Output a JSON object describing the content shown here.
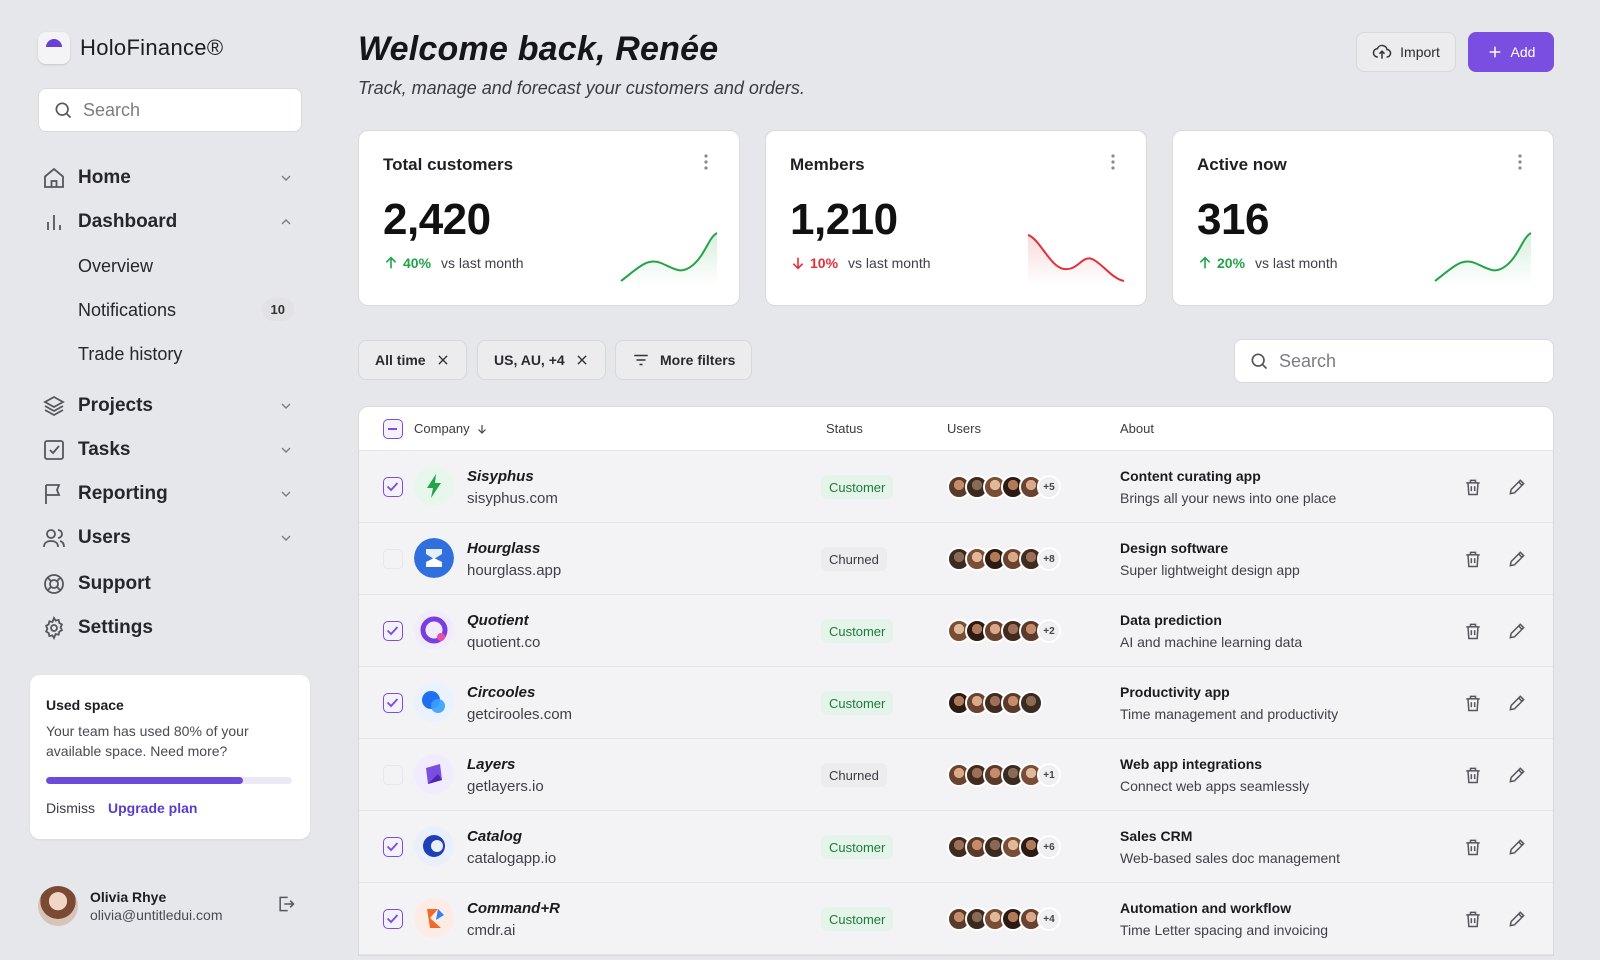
{
  "app": {
    "name": "HoloFinance®"
  },
  "sidebar": {
    "search_placeholder": "Search",
    "nav": [
      {
        "label": "Home",
        "icon": "home-icon",
        "expanded": false
      },
      {
        "label": "Dashboard",
        "icon": "bar-chart-icon",
        "expanded": true
      },
      {
        "label": "Projects",
        "icon": "layers-icon",
        "expanded": false
      },
      {
        "label": "Tasks",
        "icon": "check-square-icon",
        "expanded": false
      },
      {
        "label": "Reporting",
        "icon": "flag-icon",
        "expanded": false
      },
      {
        "label": "Users",
        "icon": "users-icon",
        "expanded": false
      },
      {
        "label": "Support",
        "icon": "life-buoy-icon"
      },
      {
        "label": "Settings",
        "icon": "gear-icon"
      }
    ],
    "dashboard_sub": [
      {
        "label": "Overview"
      },
      {
        "label": "Notifications",
        "badge": "10"
      },
      {
        "label": "Trade history"
      }
    ],
    "space_card": {
      "title": "Used space",
      "description": "Your team has used 80% of your available space. Need more?",
      "progress_percent": 80,
      "dismiss": "Dismiss",
      "upgrade": "Upgrade plan"
    },
    "user": {
      "name": "Olivia Rhye",
      "email": "olivia@untitledui.com"
    }
  },
  "header": {
    "title": "Welcome back, Renée",
    "subtitle": "Track, manage and forecast your customers and orders.",
    "import_label": "Import",
    "add_label": "Add"
  },
  "stats": [
    {
      "title": "Total customers",
      "value": "2,420",
      "pct": "40%",
      "direction": "up",
      "vs": "vs last month",
      "color": "#22a447"
    },
    {
      "title": "Members",
      "value": "1,210",
      "pct": "10%",
      "direction": "down",
      "vs": "vs last month",
      "color": "#e0303a"
    },
    {
      "title": "Active now",
      "value": "316",
      "pct": "20%",
      "direction": "up",
      "vs": "vs last month",
      "color": "#22a447"
    }
  ],
  "filters": {
    "chips": [
      "All time",
      "US, AU, +4"
    ],
    "more_filters": "More filters",
    "search_placeholder": "Search"
  },
  "table": {
    "headers": {
      "company": "Company",
      "status": "Status",
      "users": "Users",
      "about": "About"
    },
    "rows": [
      {
        "checked": true,
        "name": "Sisyphus",
        "url": "sisyphus.com",
        "status": "Customer",
        "users_extra": "+5",
        "about_title": "Content curating app",
        "about_desc": "Brings all your news into one place",
        "logo": "sisyphus"
      },
      {
        "checked": false,
        "name": "Hourglass",
        "url": "hourglass.app",
        "status": "Churned",
        "users_extra": "+8",
        "about_title": "Design software",
        "about_desc": "Super lightweight design app",
        "logo": "hourglass"
      },
      {
        "checked": true,
        "name": "Quotient",
        "url": "quotient.co",
        "status": "Customer",
        "users_extra": "+2",
        "about_title": "Data prediction",
        "about_desc": "AI and machine learning data",
        "logo": "quotient"
      },
      {
        "checked": true,
        "name": "Circooles",
        "url": "getcirooles.com",
        "status": "Customer",
        "users_extra": "",
        "about_title": "Productivity app",
        "about_desc": "Time management and productivity",
        "logo": "circooles"
      },
      {
        "checked": false,
        "name": "Layers",
        "url": "getlayers.io",
        "status": "Churned",
        "users_extra": "+1",
        "about_title": "Web app integrations",
        "about_desc": "Connect web apps seamlessly",
        "logo": "layers"
      },
      {
        "checked": true,
        "name": "Catalog",
        "url": "catalogapp.io",
        "status": "Customer",
        "users_extra": "+6",
        "about_title": "Sales CRM",
        "about_desc": "Web-based sales doc management",
        "logo": "catalog"
      },
      {
        "checked": true,
        "name": "Command+R",
        "url": "cmdr.ai",
        "status": "Customer",
        "users_extra": "+4",
        "about_title": "Automation and workflow",
        "about_desc": "Time Letter spacing and invoicing",
        "logo": "commandr"
      }
    ]
  }
}
